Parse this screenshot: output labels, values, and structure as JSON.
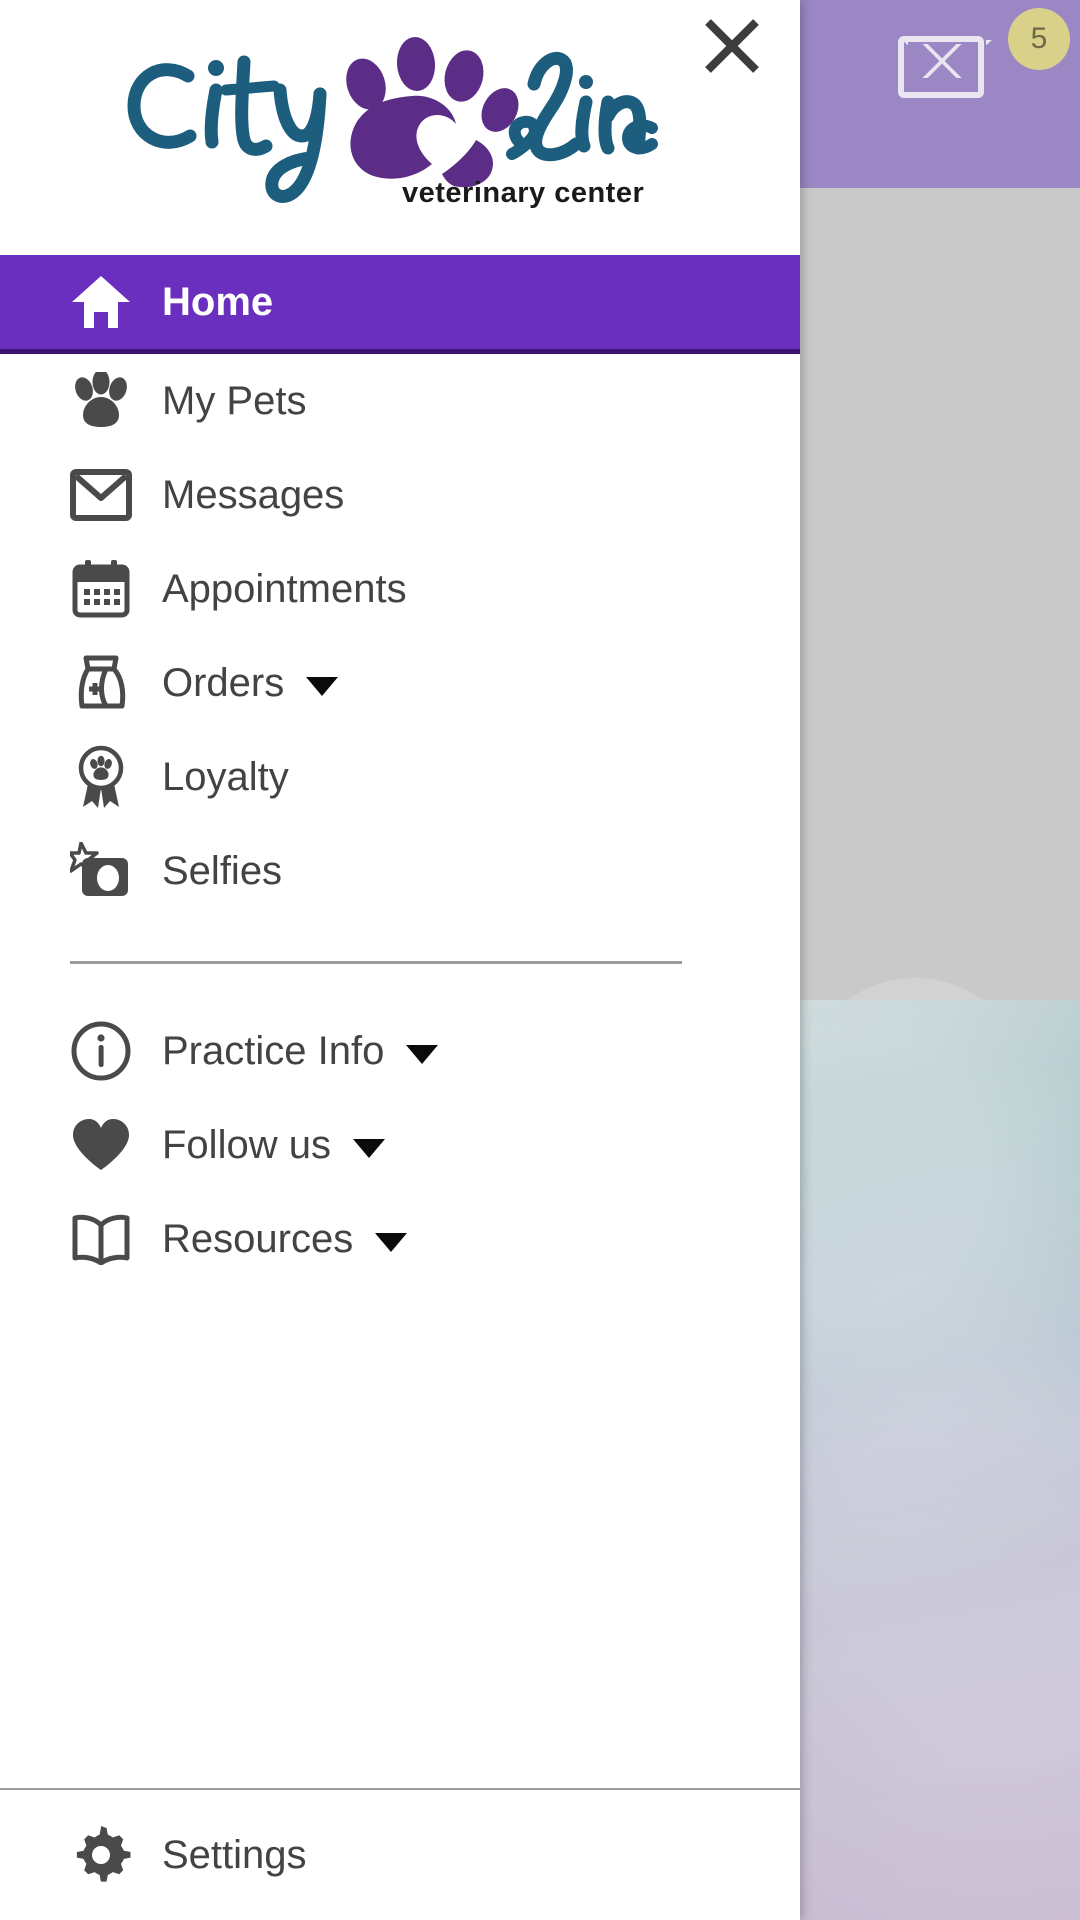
{
  "brand": {
    "name_part1": "City",
    "name_part2": "Line",
    "subtitle": "veterinary center",
    "script_color": "#1d5d7e",
    "paw_color": "#5c2d87",
    "subtitle_color": "#1a1a1a"
  },
  "colors": {
    "selected_bg": "#6b2fbf",
    "selected_border": "#3d1472",
    "icon": "#4a4a4a",
    "label": "#434343",
    "divider": "#9c9c9c",
    "badge_bg": "#d9d18a",
    "bg_header": "#9b87c4"
  },
  "header": {
    "close_label": "Close",
    "close_icon": "close-icon"
  },
  "background": {
    "unread_badge_count": "5",
    "envelope_icon": "envelope-icon"
  },
  "nav": {
    "primary": [
      {
        "label": "Home",
        "icon": "home-icon",
        "selected": true,
        "expandable": false
      },
      {
        "label": "My Pets",
        "icon": "paw-icon",
        "selected": false,
        "expandable": false
      },
      {
        "label": "Messages",
        "icon": "envelope-icon",
        "selected": false,
        "expandable": false
      },
      {
        "label": "Appointments",
        "icon": "calendar-icon",
        "selected": false,
        "expandable": false
      },
      {
        "label": "Orders",
        "icon": "food-bag-icon",
        "selected": false,
        "expandable": true
      },
      {
        "label": "Loyalty",
        "icon": "award-paw-icon",
        "selected": false,
        "expandable": false
      },
      {
        "label": "Selfies",
        "icon": "camera-star-icon",
        "selected": false,
        "expandable": false
      }
    ],
    "secondary": [
      {
        "label": "Practice Info",
        "icon": "info-circle-icon",
        "selected": false,
        "expandable": true
      },
      {
        "label": "Follow us",
        "icon": "heart-icon",
        "selected": false,
        "expandable": true
      },
      {
        "label": "Resources",
        "icon": "book-icon",
        "selected": false,
        "expandable": true
      }
    ],
    "footer": [
      {
        "label": "Settings",
        "icon": "gear-icon",
        "selected": false,
        "expandable": false
      }
    ]
  }
}
